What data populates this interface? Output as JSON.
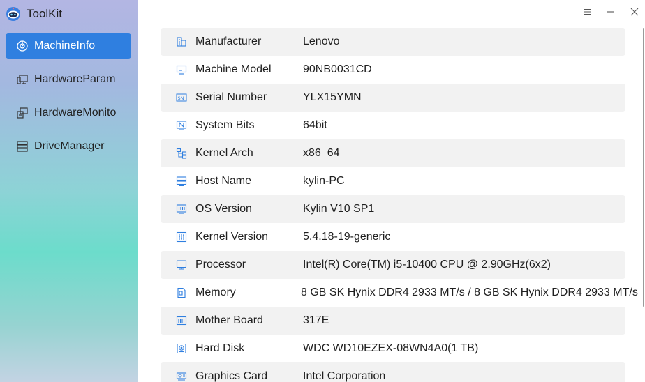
{
  "app": {
    "title": "ToolKit"
  },
  "sidebar": {
    "items": [
      {
        "label": "MachineInfo",
        "icon": "dashboard-icon",
        "active": true
      },
      {
        "label": "HardwareParam",
        "icon": "hardware-icon",
        "active": false
      },
      {
        "label": "HardwareMonito",
        "icon": "monitor-icon",
        "active": false
      },
      {
        "label": "DriveManager",
        "icon": "drive-icon",
        "active": false
      }
    ]
  },
  "window_controls": {
    "menu": "menu-icon",
    "minimize": "minimize-icon",
    "close": "close-icon"
  },
  "info_rows": [
    {
      "label": "Manufacturer",
      "value": "Lenovo",
      "icon": "manufacturer-icon"
    },
    {
      "label": "Machine Model",
      "value": "90NB0031CD",
      "icon": "machine-model-icon"
    },
    {
      "label": "Serial Number",
      "value": "YLX15YMN",
      "icon": "serial-number-icon"
    },
    {
      "label": "System Bits",
      "value": "64bit",
      "icon": "system-bits-icon"
    },
    {
      "label": "Kernel Arch",
      "value": "x86_64",
      "icon": "kernel-arch-icon"
    },
    {
      "label": "Host Name",
      "value": "kylin-PC",
      "icon": "host-name-icon"
    },
    {
      "label": "OS Version",
      "value": "Kylin V10 SP1",
      "icon": "os-version-icon"
    },
    {
      "label": "Kernel Version",
      "value": "5.4.18-19-generic",
      "icon": "kernel-version-icon"
    },
    {
      "label": "Processor",
      "value": "Intel(R) Core(TM) i5-10400 CPU @ 2.90GHz(6x2)",
      "icon": "processor-icon"
    },
    {
      "label": "Memory",
      "value": "8 GB SK Hynix DDR4 2933 MT/s / 8 GB SK Hynix DDR4 2933 MT/s",
      "icon": "memory-icon"
    },
    {
      "label": "Mother Board",
      "value": "317E",
      "icon": "mother-board-icon"
    },
    {
      "label": "Hard Disk",
      "value": "WDC WD10EZEX-08WN4A0(1 TB)",
      "icon": "hard-disk-icon"
    },
    {
      "label": "Graphics Card",
      "value": "Intel Corporation",
      "icon": "graphics-card-icon"
    }
  ],
  "colors": {
    "accent": "#2f7fe0",
    "icon_blue": "#2f7fe0",
    "row_stripe": "#f2f2f2"
  }
}
